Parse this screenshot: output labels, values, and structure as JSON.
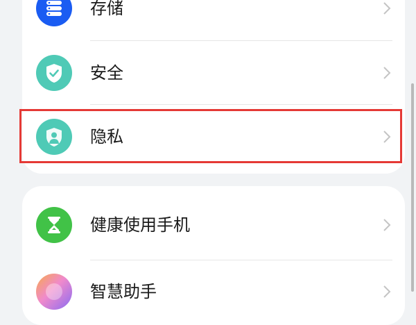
{
  "settings_group_1": {
    "items": [
      {
        "label": "存储",
        "icon": "storage-icon",
        "color": "#1a5cf2"
      },
      {
        "label": "安全",
        "icon": "security-shield-icon",
        "color": "#4fcab6"
      },
      {
        "label": "隐私",
        "icon": "privacy-shield-icon",
        "color": "#4fcab6"
      }
    ]
  },
  "settings_group_2": {
    "items": [
      {
        "label": "健康使用手机",
        "icon": "hourglass-icon",
        "color": "#41c247"
      },
      {
        "label": "智慧助手",
        "icon": "assistant-icon",
        "color": "#f08acb"
      }
    ]
  },
  "highlight": {
    "target": "隐私",
    "color": "#e53935"
  }
}
